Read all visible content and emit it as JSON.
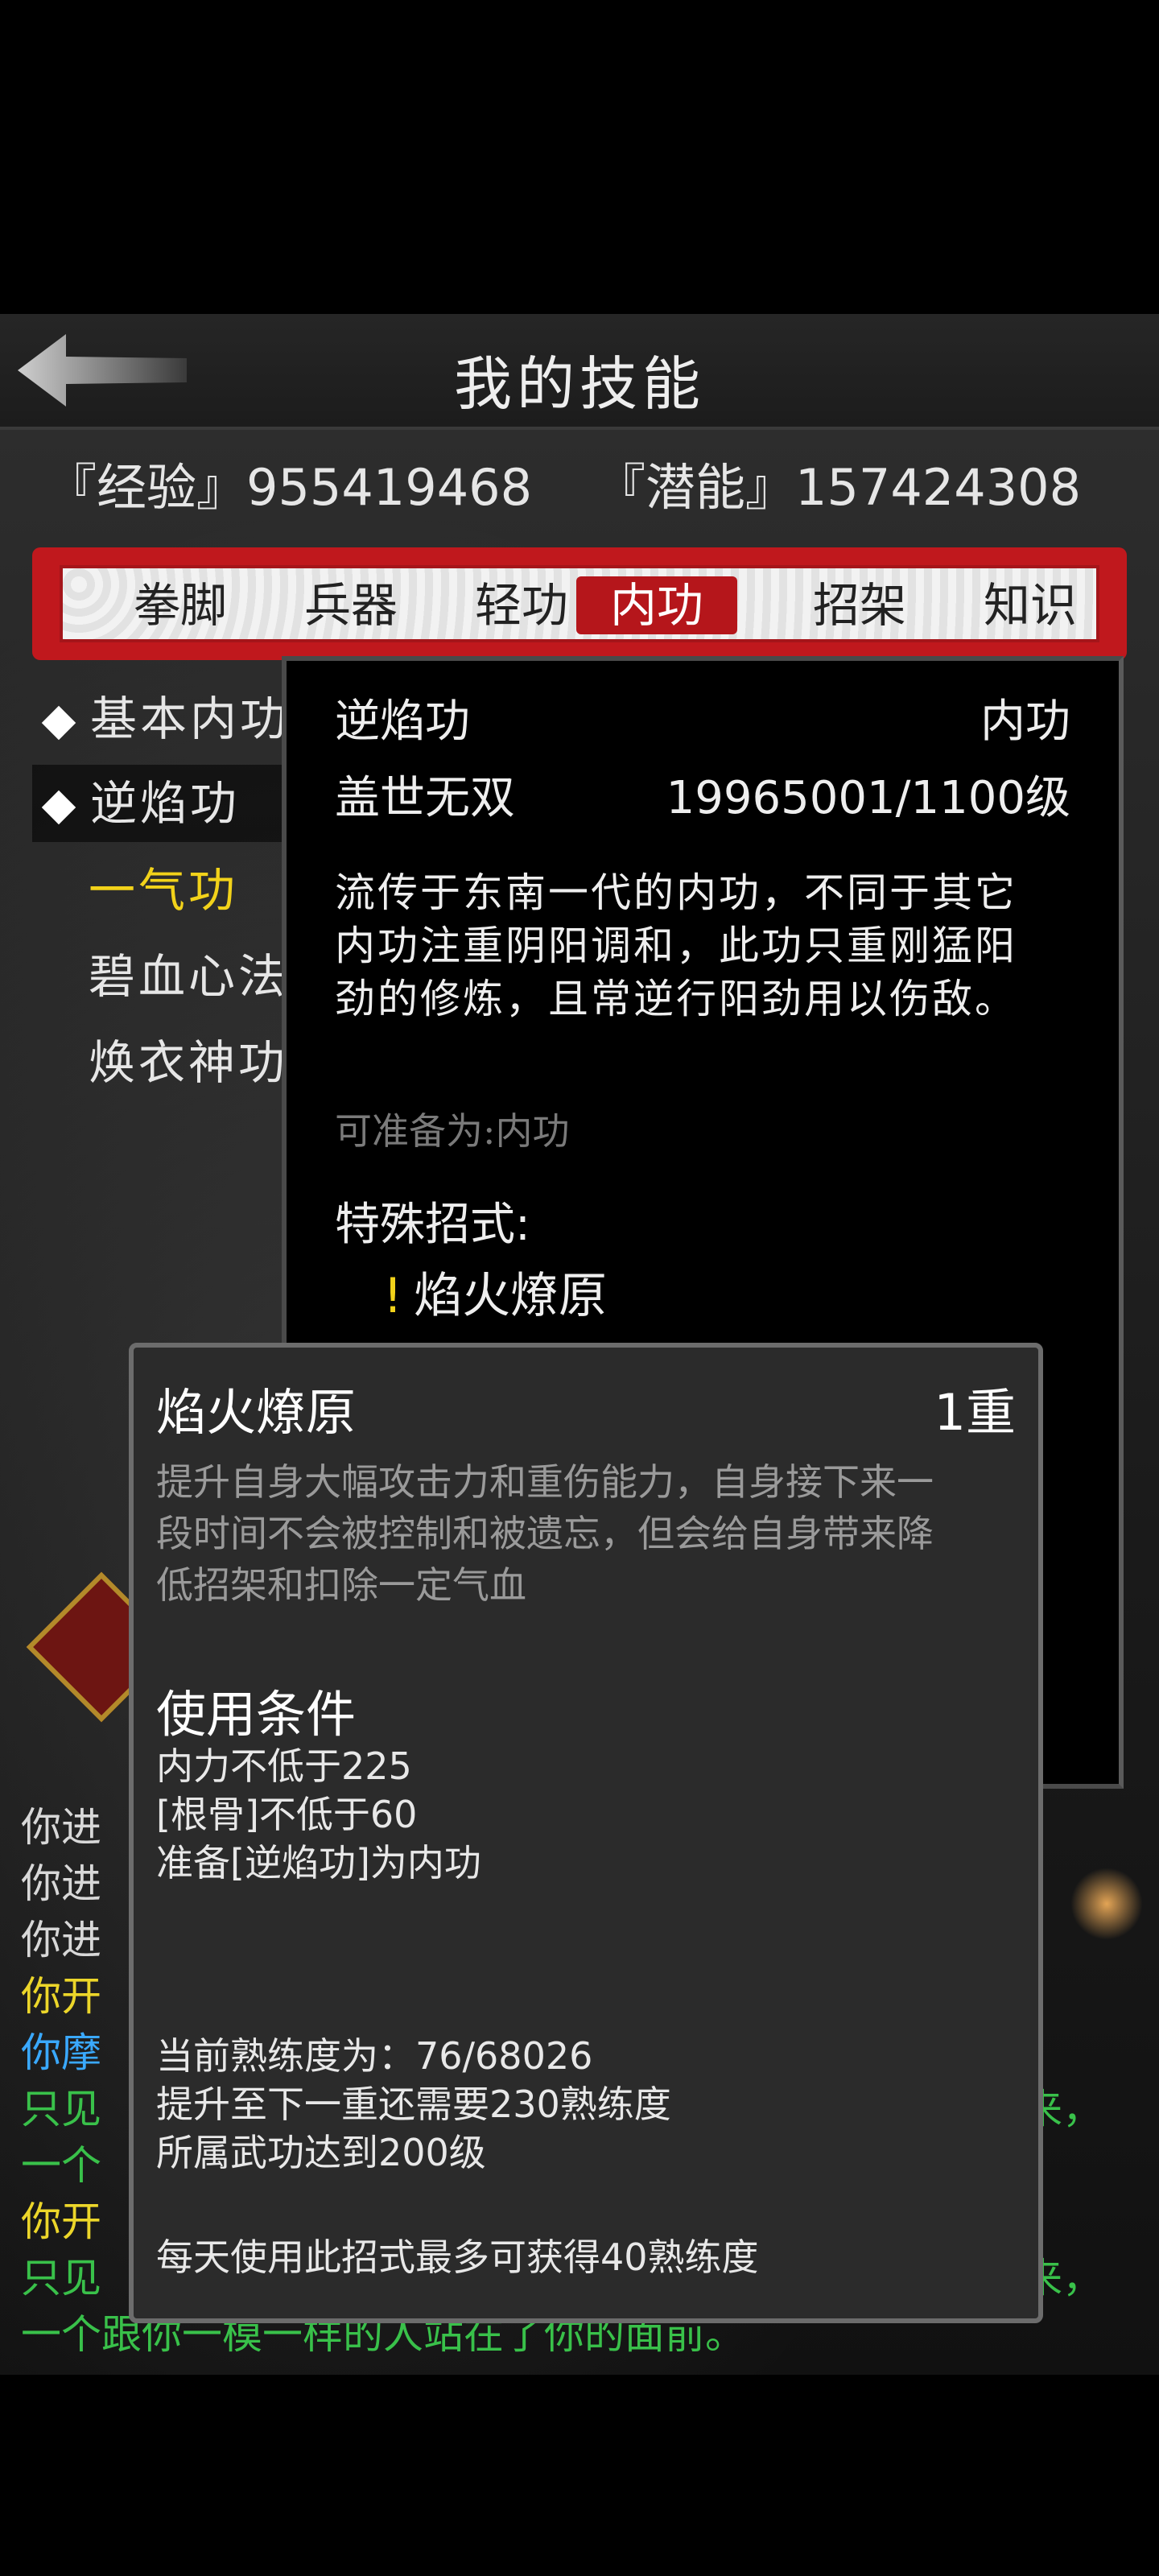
{
  "header": {
    "title": "我的技能"
  },
  "stats": {
    "exp_label": "『经验』",
    "exp_value": "955419468",
    "pot_label": "『潜能』",
    "pot_value": "157424308"
  },
  "tabs": [
    {
      "label": "拳脚"
    },
    {
      "label": "兵器"
    },
    {
      "label": "轻功"
    },
    {
      "label": "内功",
      "active": true
    },
    {
      "label": "招架"
    },
    {
      "label": "知识"
    }
  ],
  "skills": [
    {
      "label": "基本内功",
      "visible": "基本内功"
    },
    {
      "label": "逆焰功",
      "visible": "逆焰功"
    },
    {
      "label": "一气功",
      "visible": "一气功"
    },
    {
      "label": "碧血心法",
      "visible": "碧血心法"
    },
    {
      "label": "焕衣神功",
      "visible": "焕衣神功"
    }
  ],
  "skill_visible": [
    "基本内功",
    "逆焰功",
    "一气功",
    "碧血心法",
    "焕衣神功"
  ],
  "skill_panel": {
    "name": "逆焰功",
    "type": "内功",
    "rank": "盖世无双",
    "level": "19965001/1100级",
    "description_lines": [
      "流传于东南一代的内功，不同于其它",
      "内功注重阴阳调和，此功只重刚猛阳",
      "劲的修炼，且常逆行阳劲用以伤敌。"
    ],
    "prep": "可准备为:内功",
    "special_title": "特殊招式:",
    "special_mark": "!",
    "special_move": "焰火燎原"
  },
  "move_popup": {
    "name": "焰火燎原",
    "level": "1重",
    "description_lines": [
      "提升自身大幅攻击力和重伤能力，自身接下来一",
      "段时间不会被控制和被遗忘，但会给自身带来降",
      "低招架和扣除一定气血"
    ],
    "conditions_title": "使用条件",
    "conditions": [
      "内力不低于225",
      "[根骨]不低于60",
      "准备[逆焰功]为内功"
    ],
    "proficiency": "当前熟练度为：76/68026",
    "next_need": "提升至下一重还需要230熟练度",
    "req_level": "所属武功达到200级",
    "daily": "每天使用此招式最多可获得40熟练度"
  },
  "chat": [
    {
      "text": "你进入",
      "color": "white"
    },
    {
      "text": "你进入",
      "color": "white"
    },
    {
      "text": "你进入",
      "color": "white"
    },
    {
      "text": "你开始",
      "color": "yellow"
    },
    {
      "text": "你摩拳",
      "color": "blue"
    },
    {
      "text": "只见你",
      "color": "green",
      "right": "来，"
    },
    {
      "text": "一个跟",
      "color": "green"
    },
    {
      "text": "你开始",
      "color": "yellow"
    },
    {
      "text": "只见你",
      "color": "green",
      "right": "来，"
    },
    {
      "text": "一个跟你一模一样的人站在了你的面前。",
      "color": "green"
    }
  ],
  "chat_visible": [
    "你进",
    "你进",
    "你进",
    "你开",
    "你摩",
    "只见",
    "一个",
    "你开",
    "只见",
    "一个跟你一模一样的人站在了你的面前。"
  ],
  "chat_right": [
    "来，",
    "来，"
  ]
}
